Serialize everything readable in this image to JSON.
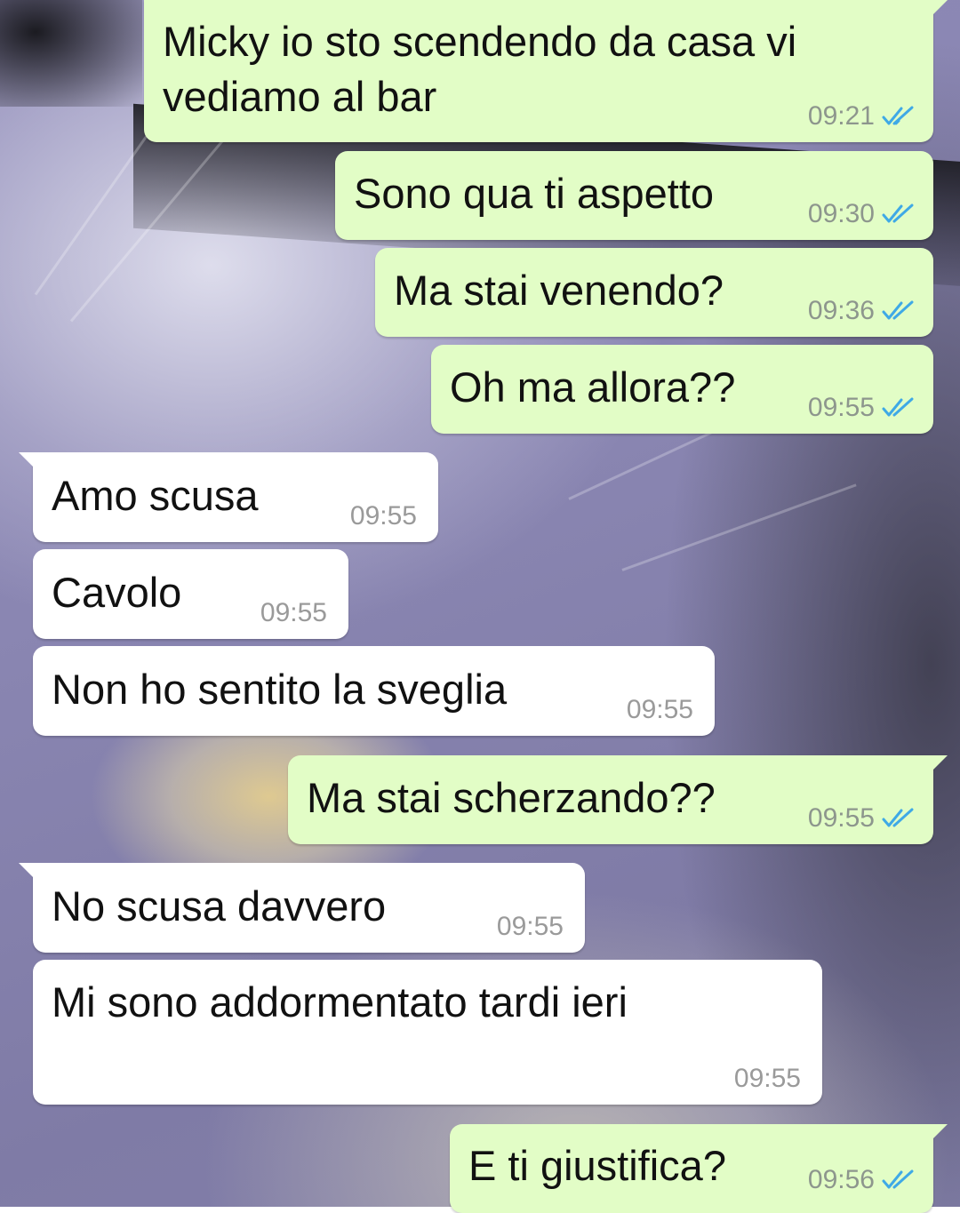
{
  "chat": {
    "messages": [
      {
        "direction": "out",
        "text": "Micky io sto scendendo da casa vi\nvediamo al bar",
        "time": "09:21",
        "status": "read"
      },
      {
        "direction": "out",
        "text": "Sono qua ti aspetto",
        "time": "09:30",
        "status": "read"
      },
      {
        "direction": "out",
        "text": "Ma stai venendo?",
        "time": "09:36",
        "status": "read"
      },
      {
        "direction": "out",
        "text": "Oh ma allora??",
        "time": "09:55",
        "status": "read"
      },
      {
        "direction": "in",
        "text": "Amo scusa",
        "time": "09:55"
      },
      {
        "direction": "in",
        "text": "Cavolo",
        "time": "09:55"
      },
      {
        "direction": "in",
        "text": "Non ho sentito la sveglia",
        "time": "09:55"
      },
      {
        "direction": "out",
        "text": "Ma stai scherzando??",
        "time": "09:55",
        "status": "read"
      },
      {
        "direction": "in",
        "text": "No scusa davvero",
        "time": "09:55"
      },
      {
        "direction": "in",
        "text": "Mi sono addormentato tardi ieri",
        "time": "09:55"
      },
      {
        "direction": "out",
        "text": "E ti giustifica?",
        "time": "09:56",
        "status": "read"
      }
    ],
    "icons": {
      "read_receipt": "double-check-icon"
    },
    "colors": {
      "outgoing_bubble": "#e2fdc6",
      "incoming_bubble": "#ffffff",
      "read_tick": "#3fa9e6",
      "wallpaper": "#8a86b2"
    }
  }
}
